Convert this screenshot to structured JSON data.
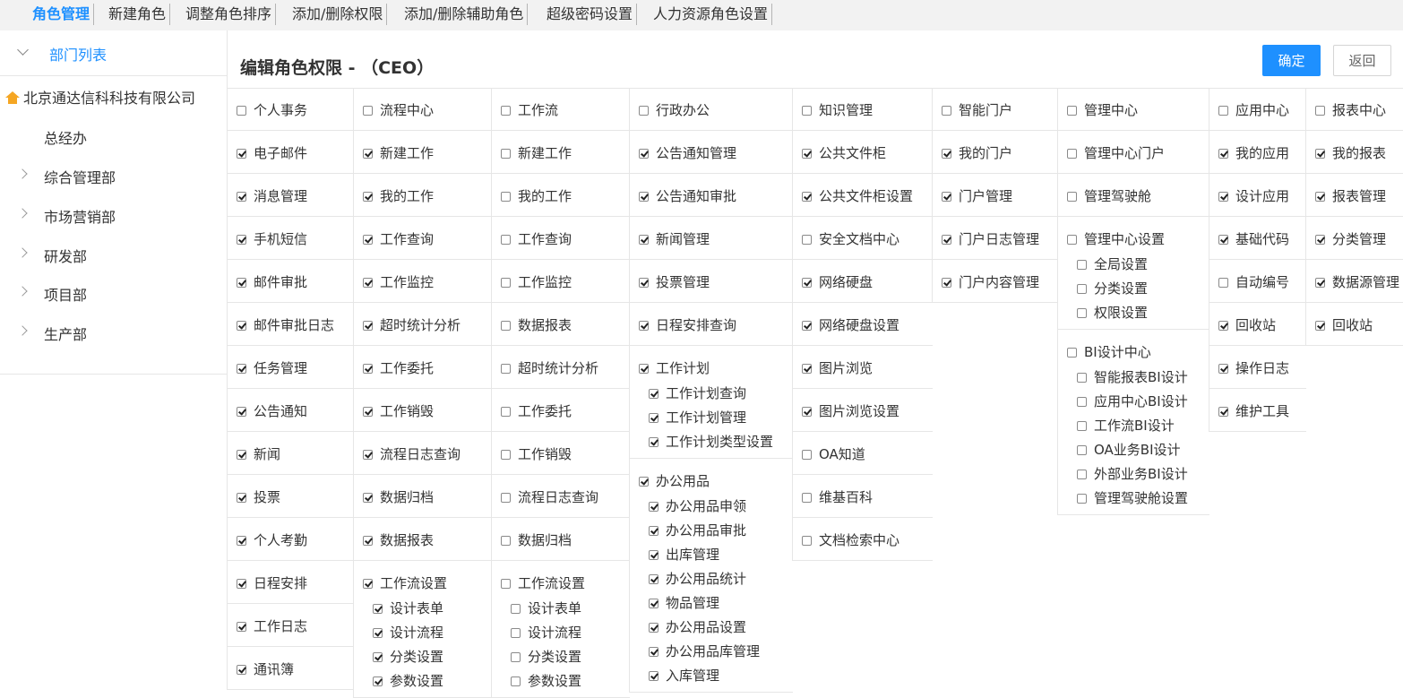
{
  "topnav": {
    "tabs": [
      "角色管理",
      "新建角色",
      "调整角色排序",
      "添加/删除权限",
      "添加/删除辅助角色",
      "超级密码设置",
      "人力资源角色设置"
    ]
  },
  "sidebar": {
    "title": "部门列表",
    "root": "北京通达信科科技有限公司",
    "items": [
      "总经办",
      "综合管理部",
      "市场营销部",
      "研发部",
      "项目部",
      "生产部"
    ]
  },
  "header": {
    "title": "编辑角色权限 - （CEO）",
    "confirm": "确定",
    "back": "返回"
  },
  "colors": {
    "accent": "#1e90ff",
    "home_icon": "#f5a623"
  },
  "columns": [
    {
      "header": "个人事务",
      "items": [
        {
          "label": "电子邮件",
          "checked": true
        },
        {
          "label": "消息管理",
          "checked": true
        },
        {
          "label": "手机短信",
          "checked": true
        },
        {
          "label": "邮件审批",
          "checked": true
        },
        {
          "label": "邮件审批日志",
          "checked": true
        },
        {
          "label": "任务管理",
          "checked": true
        },
        {
          "label": "公告通知",
          "checked": true
        },
        {
          "label": "新闻",
          "checked": true
        },
        {
          "label": "投票",
          "checked": true
        },
        {
          "label": "个人考勤",
          "checked": true
        },
        {
          "label": "日程安排",
          "checked": true
        },
        {
          "label": "工作日志",
          "checked": true
        },
        {
          "label": "通讯簿",
          "checked": true
        }
      ]
    },
    {
      "header": "流程中心",
      "items": [
        {
          "label": "新建工作",
          "checked": true
        },
        {
          "label": "我的工作",
          "checked": true
        },
        {
          "label": "工作查询",
          "checked": true
        },
        {
          "label": "工作监控",
          "checked": true
        },
        {
          "label": "超时统计分析",
          "checked": true
        },
        {
          "label": "工作委托",
          "checked": true
        },
        {
          "label": "工作销毁",
          "checked": true
        },
        {
          "label": "流程日志查询",
          "checked": true
        },
        {
          "label": "数据归档",
          "checked": true
        },
        {
          "label": "数据报表",
          "checked": true
        },
        {
          "label": "工作流设置",
          "checked": true,
          "children": [
            {
              "label": "设计表单",
              "checked": true
            },
            {
              "label": "设计流程",
              "checked": true
            },
            {
              "label": "分类设置",
              "checked": true
            },
            {
              "label": "参数设置",
              "checked": true
            }
          ]
        }
      ]
    },
    {
      "header": "工作流",
      "items": [
        {
          "label": "新建工作",
          "checked": false
        },
        {
          "label": "我的工作",
          "checked": false
        },
        {
          "label": "工作查询",
          "checked": false
        },
        {
          "label": "工作监控",
          "checked": false
        },
        {
          "label": "数据报表",
          "checked": false
        },
        {
          "label": "超时统计分析",
          "checked": false
        },
        {
          "label": "工作委托",
          "checked": false
        },
        {
          "label": "工作销毁",
          "checked": false
        },
        {
          "label": "流程日志查询",
          "checked": false
        },
        {
          "label": "数据归档",
          "checked": false
        },
        {
          "label": "工作流设置",
          "checked": false,
          "children": [
            {
              "label": "设计表单",
              "checked": false
            },
            {
              "label": "设计流程",
              "checked": false
            },
            {
              "label": "分类设置",
              "checked": false
            },
            {
              "label": "参数设置",
              "checked": false
            }
          ]
        }
      ]
    },
    {
      "header": "行政办公",
      "items": [
        {
          "label": "公告通知管理",
          "checked": true
        },
        {
          "label": "公告通知审批",
          "checked": true
        },
        {
          "label": "新闻管理",
          "checked": true
        },
        {
          "label": "投票管理",
          "checked": true
        },
        {
          "label": "日程安排查询",
          "checked": true
        },
        {
          "label": "工作计划",
          "checked": true,
          "children": [
            {
              "label": "工作计划查询",
              "checked": true
            },
            {
              "label": "工作计划管理",
              "checked": true
            },
            {
              "label": "工作计划类型设置",
              "checked": true
            }
          ]
        },
        {
          "label": "办公用品",
          "checked": true,
          "children": [
            {
              "label": "办公用品申领",
              "checked": true
            },
            {
              "label": "办公用品审批",
              "checked": true
            },
            {
              "label": "出库管理",
              "checked": true
            },
            {
              "label": "办公用品统计",
              "checked": true
            },
            {
              "label": "物品管理",
              "checked": true
            },
            {
              "label": "办公用品设置",
              "checked": true
            },
            {
              "label": "办公用品库管理",
              "checked": true
            },
            {
              "label": "入库管理",
              "checked": true
            }
          ]
        }
      ]
    },
    {
      "header": "知识管理",
      "items": [
        {
          "label": "公共文件柜",
          "checked": true
        },
        {
          "label": "公共文件柜设置",
          "checked": true
        },
        {
          "label": "安全文档中心",
          "checked": false
        },
        {
          "label": "网络硬盘",
          "checked": true
        },
        {
          "label": "网络硬盘设置",
          "checked": true
        },
        {
          "label": "图片浏览",
          "checked": true
        },
        {
          "label": "图片浏览设置",
          "checked": true
        },
        {
          "label": "OA知道",
          "checked": false
        },
        {
          "label": "维基百科",
          "checked": false
        },
        {
          "label": "文档检索中心",
          "checked": false
        }
      ]
    },
    {
      "header": "智能门户",
      "items": [
        {
          "label": "我的门户",
          "checked": true
        },
        {
          "label": "门户管理",
          "checked": true
        },
        {
          "label": "门户日志管理",
          "checked": true
        },
        {
          "label": "门户内容管理",
          "checked": true
        }
      ]
    },
    {
      "header": "管理中心",
      "items": [
        {
          "label": "管理中心门户",
          "checked": false
        },
        {
          "label": "管理驾驶舱",
          "checked": false
        },
        {
          "label": "管理中心设置",
          "checked": false,
          "children": [
            {
              "label": "全局设置",
              "checked": false
            },
            {
              "label": "分类设置",
              "checked": false
            },
            {
              "label": "权限设置",
              "checked": false
            }
          ]
        },
        {
          "label": "BI设计中心",
          "checked": false,
          "children": [
            {
              "label": "智能报表BI设计",
              "checked": false
            },
            {
              "label": "应用中心BI设计",
              "checked": false
            },
            {
              "label": "工作流BI设计",
              "checked": false
            },
            {
              "label": "OA业务BI设计",
              "checked": false
            },
            {
              "label": "外部业务BI设计",
              "checked": false
            },
            {
              "label": "管理驾驶舱设置",
              "checked": false
            }
          ]
        }
      ]
    },
    {
      "header": "应用中心",
      "items": [
        {
          "label": "我的应用",
          "checked": true
        },
        {
          "label": "设计应用",
          "checked": true
        },
        {
          "label": "基础代码",
          "checked": true
        },
        {
          "label": "自动编号",
          "checked": false
        },
        {
          "label": "回收站",
          "checked": true
        },
        {
          "label": "操作日志",
          "checked": true
        },
        {
          "label": "维护工具",
          "checked": true
        }
      ]
    },
    {
      "header": "报表中心",
      "items": [
        {
          "label": "我的报表",
          "checked": true
        },
        {
          "label": "报表管理",
          "checked": true
        },
        {
          "label": "分类管理",
          "checked": true
        },
        {
          "label": "数据源管理",
          "checked": true
        },
        {
          "label": "回收站",
          "checked": true
        }
      ]
    }
  ]
}
